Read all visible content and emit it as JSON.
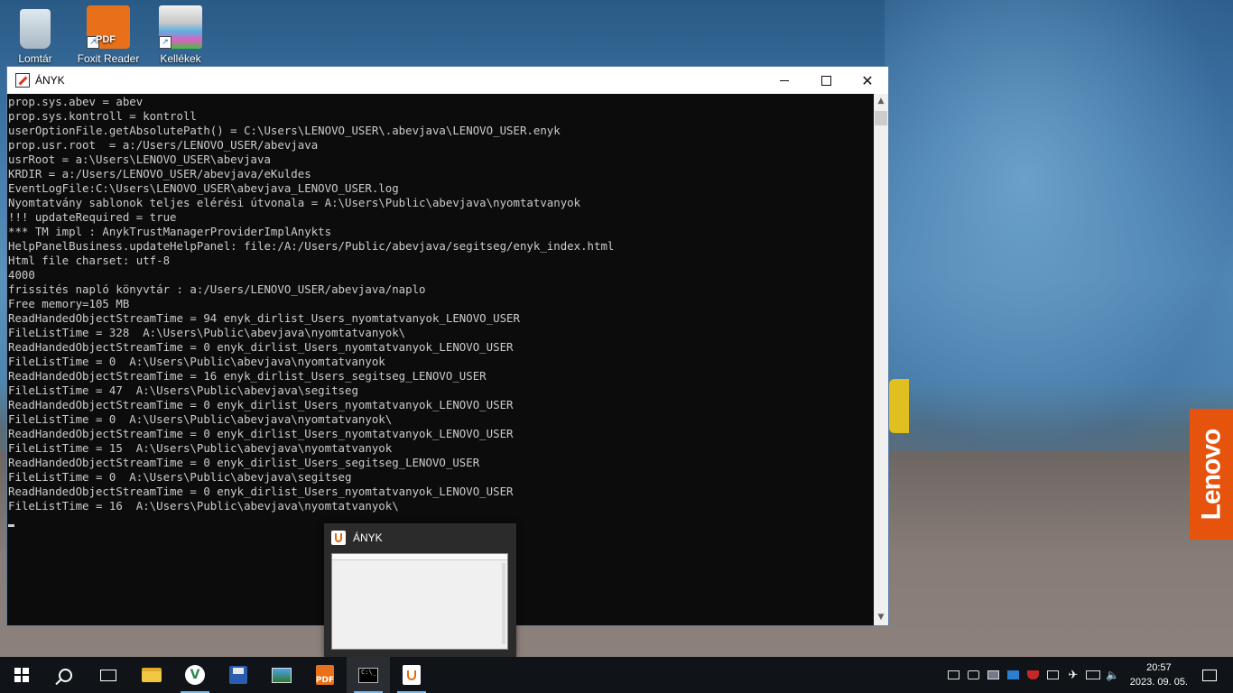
{
  "desktop": {
    "icons": [
      {
        "label": "Lomtár",
        "icon": "recycle-bin-icon"
      },
      {
        "label": "Foxit Reader",
        "icon": "foxit-reader-icon"
      },
      {
        "label": "Kellékek",
        "icon": "kellekek-icon"
      }
    ],
    "wallpaper_brand": "Lenovo"
  },
  "window": {
    "title": "ÁNYK",
    "controls": {
      "minimize": "minimize",
      "maximize": "maximize",
      "close": "✕"
    },
    "console_lines": [
      "prop.sys.abev = abev",
      "prop.sys.kontroll = kontroll",
      "userOptionFile.getAbsolutePath() = C:\\Users\\LENOVO_USER\\.abevjava\\LENOVO_USER.enyk",
      "prop.usr.root  = a:/Users/LENOVO_USER/abevjava",
      "usrRoot = a:\\Users\\LENOVO_USER\\abevjava",
      "KRDIR = a:/Users/LENOVO_USER/abevjava/eKuldes",
      "EventLogFile:C:\\Users\\LENOVO_USER\\abevjava_LENOVO_USER.log",
      "Nyomtatvány sablonok teljes elérési útvonala = A:\\Users\\Public\\abevjava\\nyomtatvanyok",
      "!!! updateRequired = true",
      "*** TM impl : AnykTrustManagerProviderImplAnykts",
      "HelpPanelBusiness.updateHelpPanel: file:/A:/Users/Public/abevjava/segitseg/enyk_index.html",
      "Html file charset: utf-8",
      "4000",
      "frissités napló könyvtár : a:/Users/LENOVO_USER/abevjava/naplo",
      "Free memory=105 MB",
      "ReadHandedObjectStreamTime = 94 enyk_dirlist_Users_nyomtatvanyok_LENOVO_USER",
      "FileListTime = 328  A:\\Users\\Public\\abevjava\\nyomtatvanyok\\",
      "ReadHandedObjectStreamTime = 0 enyk_dirlist_Users_nyomtatvanyok_LENOVO_USER",
      "FileListTime = 0  A:\\Users\\Public\\abevjava\\nyomtatvanyok",
      "ReadHandedObjectStreamTime = 16 enyk_dirlist_Users_segitseg_LENOVO_USER",
      "FileListTime = 47  A:\\Users\\Public\\abevjava\\segitseg",
      "ReadHandedObjectStreamTime = 0 enyk_dirlist_Users_nyomtatvanyok_LENOVO_USER",
      "FileListTime = 0  A:\\Users\\Public\\abevjava\\nyomtatvanyok\\",
      "ReadHandedObjectStreamTime = 0 enyk_dirlist_Users_nyomtatvanyok_LENOVO_USER",
      "FileListTime = 15  A:\\Users\\Public\\abevjava\\nyomtatvanyok",
      "ReadHandedObjectStreamTime = 0 enyk_dirlist_Users_segitseg_LENOVO_USER",
      "FileListTime = 0  A:\\Users\\Public\\abevjava\\segitseg",
      "ReadHandedObjectStreamTime = 0 enyk_dirlist_Users_nyomtatvanyok_LENOVO_USER",
      "FileListTime = 16  A:\\Users\\Public\\abevjava\\nyomtatvanyok\\"
    ]
  },
  "preview": {
    "title": "ÁNYK"
  },
  "taskbar": {
    "apps": [
      {
        "name": "file-explorer",
        "icon": "folder-icon"
      },
      {
        "name": "v-app",
        "icon": "v-app-icon"
      },
      {
        "name": "save-app",
        "icon": "floppy-icon"
      },
      {
        "name": "photos",
        "icon": "photos-icon"
      },
      {
        "name": "foxit-reader",
        "icon": "foxit-icon"
      },
      {
        "name": "command-prompt",
        "icon": "cmd-icon"
      },
      {
        "name": "java-anyk",
        "icon": "java-icon"
      }
    ],
    "clock": {
      "time": "20:57",
      "date": "2023. 09. 05."
    }
  },
  "colors": {
    "console_bg": "#0c0c0c",
    "console_text": "#cccccc",
    "taskbar_bg": "#101418",
    "lenovo_orange": "#e5530d",
    "running_indicator": "#76b9ed"
  }
}
